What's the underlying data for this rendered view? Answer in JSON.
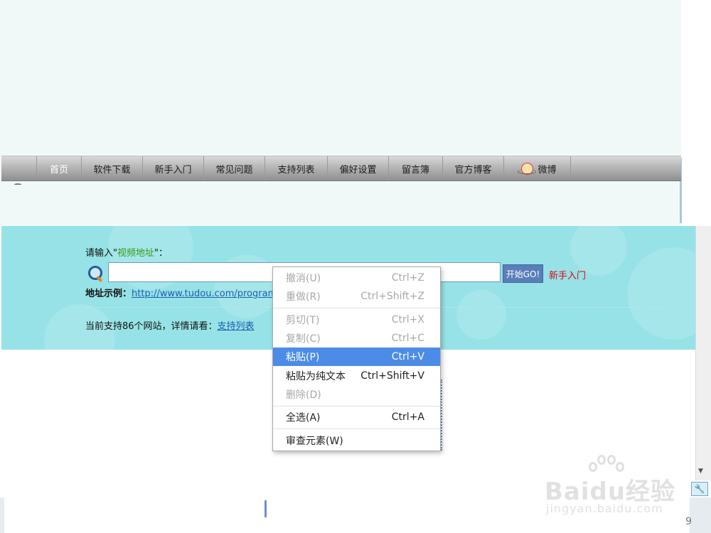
{
  "nav": {
    "items": [
      {
        "label": "首页",
        "width": 63,
        "active": true
      },
      {
        "label": "软件下载",
        "width": 86
      },
      {
        "label": "新手入门",
        "width": 86
      },
      {
        "label": "常见问题",
        "width": 86
      },
      {
        "label": "支持列表",
        "width": 88
      },
      {
        "label": "偏好设置",
        "width": 86
      },
      {
        "label": "留言簿",
        "width": 76
      },
      {
        "label": "官方博客",
        "width": 86
      },
      {
        "label": "微博",
        "width": 94,
        "icon": "weibo-icon"
      }
    ]
  },
  "search": {
    "prompt_prefix": "请输入\"",
    "prompt_highlight": "视频地址",
    "prompt_suffix": "\"：",
    "input_value": "",
    "go_label": "开始GO!",
    "newbie_link": "新手入门",
    "example_label": "地址示例：",
    "example_url": "http://www.tudou.com/programs",
    "support_text": "当前支持86个网站，详情请看：",
    "support_link": "支持列表"
  },
  "context_menu": {
    "groups": [
      [
        {
          "label": "撤消(U)",
          "shortcut": "Ctrl+Z",
          "disabled": true
        },
        {
          "label": "重做(R)",
          "shortcut": "Ctrl+Shift+Z",
          "disabled": true
        }
      ],
      [
        {
          "label": "剪切(T)",
          "shortcut": "Ctrl+X",
          "disabled": true
        },
        {
          "label": "复制(C)",
          "shortcut": "Ctrl+C",
          "disabled": true
        },
        {
          "label": "粘贴(P)",
          "shortcut": "Ctrl+V",
          "selected": true
        },
        {
          "label": "粘贴为纯文本",
          "shortcut": "Ctrl+Shift+V"
        },
        {
          "label": "删除(D)",
          "shortcut": "",
          "disabled": true
        }
      ],
      [
        {
          "label": "全选(A)",
          "shortcut": "Ctrl+A"
        }
      ],
      [
        {
          "label": "审查元素(W)",
          "shortcut": ""
        }
      ]
    ]
  },
  "watermark": {
    "main": "Baidu经验",
    "sub": "jingyan.baidu.com"
  },
  "taskbar": {
    "clock_fragment": "9"
  },
  "colors": {
    "band": "#96e2e6",
    "header_bg": "#f1f9f8",
    "menu_highlight": "#4c8ce6",
    "link_red": "#e60012",
    "highlight_green": "#3a9a16"
  }
}
